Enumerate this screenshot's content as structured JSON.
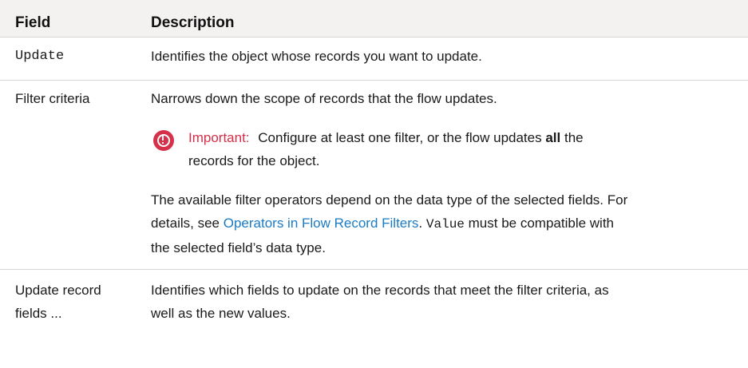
{
  "table": {
    "header": {
      "field": "Field",
      "description": "Description"
    },
    "rows": [
      {
        "field": "Update",
        "description": "Identifies the object whose records you want to update."
      },
      {
        "field": "Filter criteria",
        "description": "Narrows down the scope of records that the flow updates.",
        "important": {
          "label": "Important:",
          "text_before": "Configure at least one filter, or the flow updates",
          "bold": "all",
          "text_after_line1": "the",
          "text_line2": "records for the object."
        },
        "note": {
          "line1": "The available filter operators depend on the data type of the selected fields. For",
          "line2_prefix": "details, see",
          "link": "Operators in Flow Record Filters",
          "line2_mid": ".",
          "code": "Value",
          "line2_suffix": "must be compatible with",
          "line3": "the selected field’s data type."
        }
      },
      {
        "field_line1": "Update record",
        "field_line2": "fields ...",
        "description_line1": "Identifies which fields to update on the records that meet the filter criteria, as",
        "description_line2": "well as the new values."
      }
    ]
  },
  "colors": {
    "header_bg": "#f3f2f0",
    "important": "#d6304a",
    "link": "#1b7bc4",
    "divider": "#d6d6d6"
  },
  "icons": {
    "important": "important-exclamation-icon"
  }
}
